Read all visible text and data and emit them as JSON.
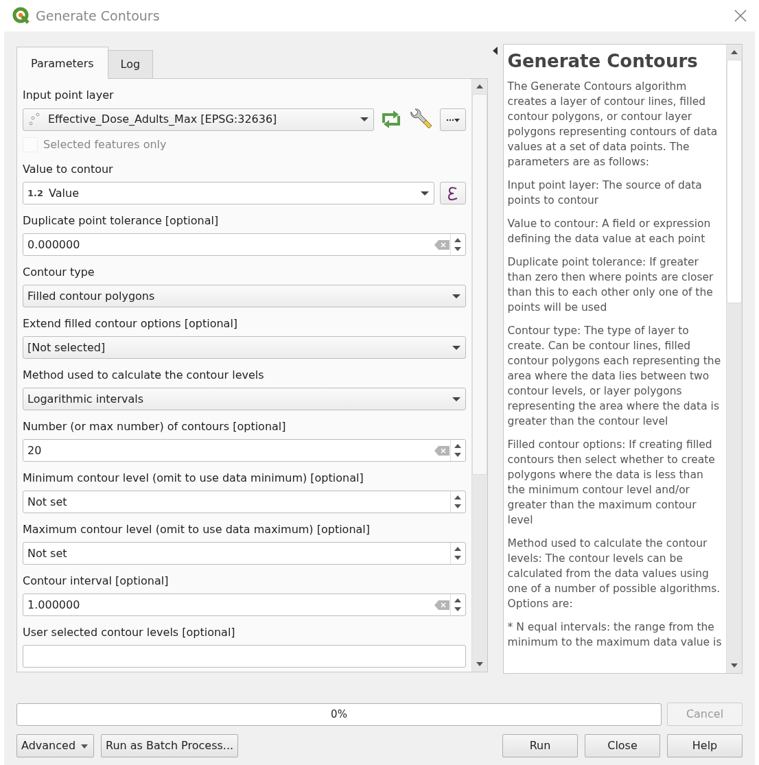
{
  "window": {
    "title": "Generate Contours"
  },
  "tabs": [
    {
      "label": "Parameters",
      "selected": true
    },
    {
      "label": "Log",
      "selected": false
    }
  ],
  "params": [
    {
      "kind": "layer",
      "label": "Input point layer",
      "value": "Effective_Dose_Adults_Max [EPSG:32636]",
      "checkbox": {
        "label": "Selected features only",
        "checked": false,
        "disabled": true
      }
    },
    {
      "kind": "field",
      "label": "Value to contour",
      "badge": "1.2",
      "value": "Value"
    },
    {
      "kind": "number",
      "label": "Duplicate point tolerance [optional]",
      "value": "0.000000",
      "clearable": true
    },
    {
      "kind": "select",
      "label": "Contour type",
      "value": "Filled contour polygons"
    },
    {
      "kind": "select",
      "label": "Extend filled contour options [optional]",
      "value": "[Not selected]"
    },
    {
      "kind": "select",
      "label": "Method used to calculate the contour levels",
      "value": "Logarithmic intervals"
    },
    {
      "kind": "number",
      "label": "Number (or max number) of contours [optional]",
      "value": "20",
      "clearable": true
    },
    {
      "kind": "number",
      "label": "Minimum contour level (omit to use data minimum) [optional]",
      "value": "Not set",
      "clearable": false
    },
    {
      "kind": "number",
      "label": "Maximum contour level (omit to use data maximum) [optional]",
      "value": "Not set",
      "clearable": false
    },
    {
      "kind": "number",
      "label": "Contour interval [optional]",
      "value": "1.000000",
      "clearable": true
    },
    {
      "kind": "text",
      "label": "User selected contour levels [optional]"
    }
  ],
  "help": {
    "title": "Generate Contours",
    "paragraphs": [
      "The Generate Contours algorithm creates a layer of contour lines, filled contour polygons, or contour layer polygons representing contours of data values at a set of data points. The parameters are as follows:",
      "Input point layer: The source of data points to contour",
      "Value to contour: A field or expression defining the data value at each point",
      "Duplicate point tolerance: If greater than zero then where points are closer than this to each other only one of the points will be used",
      "Contour type: The type of layer to create. Can be contour lines, filled contour polygons each representing the area where the data lies between two contour levels, or layer polygons representing the area where the data is greater than the contour level",
      "Filled contour options: If creating filled contours then select whether to create polygons where the data is less than the minimum contour level and/or greater than the maximum contour level",
      "Method used to calculate the contour levels: The contour levels can be calculated from the data values using one of a number of possible algorithms. Options are:",
      "* N equal intervals: the range from the minimum to the maximum data value is"
    ]
  },
  "progress": {
    "label": "0%",
    "level": 0
  },
  "buttons": [
    {
      "kind": "cancel",
      "label": "Cancel",
      "disabled": true
    },
    {
      "kind": "menu",
      "label": "Advanced",
      "disabled": false
    },
    {
      "kind": "batch",
      "label": "Run as Batch Process...",
      "disabled": false
    },
    {
      "kind": "run",
      "label": "Run",
      "disabled": false
    },
    {
      "kind": "close",
      "label": "Close",
      "disabled": false
    },
    {
      "kind": "help",
      "label": "Help",
      "disabled": false
    }
  ]
}
